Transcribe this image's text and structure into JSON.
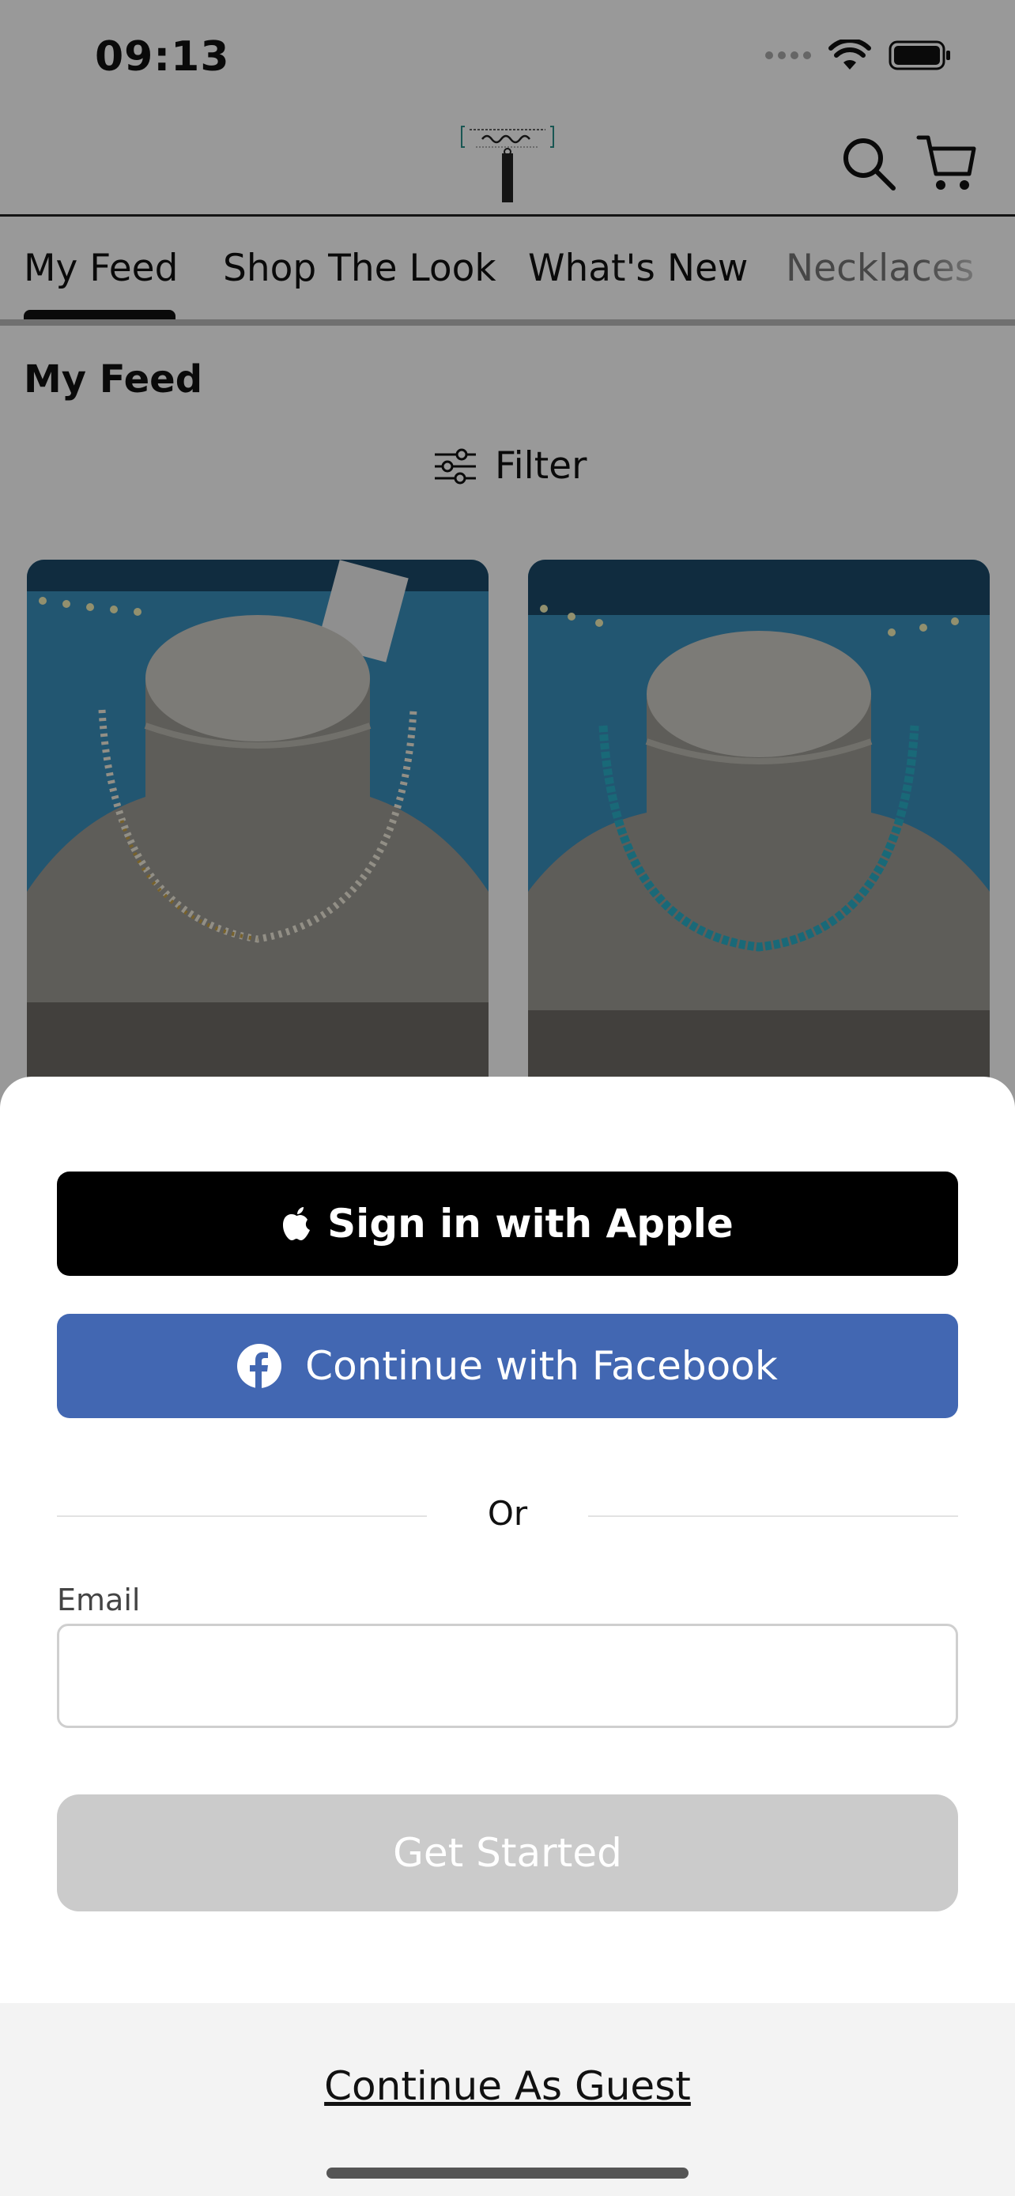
{
  "status_bar": {
    "time": "09:13"
  },
  "header": {
    "logo_alt": "Jennifer Thames Originals"
  },
  "tabs": [
    {
      "label": "My Feed"
    },
    {
      "label": "Shop The Look"
    },
    {
      "label": "What's New"
    },
    {
      "label": "Necklaces"
    }
  ],
  "feed": {
    "title": "My Feed",
    "filter_label": "Filter"
  },
  "sheet": {
    "apple_label": "Sign in with Apple",
    "facebook_label": "Continue with Facebook",
    "divider_text": "Or",
    "email_label": "Email",
    "email_value": "",
    "get_started_label": "Get Started",
    "guest_label": "Continue As Guest"
  },
  "colors": {
    "apple": "#000000",
    "facebook": "#4267b2",
    "disabled_button": "#cbcbcb"
  },
  "icons": [
    "search-icon",
    "cart-icon",
    "filter-icon",
    "apple-icon",
    "facebook-icon",
    "wifi-icon",
    "battery-icon"
  ]
}
